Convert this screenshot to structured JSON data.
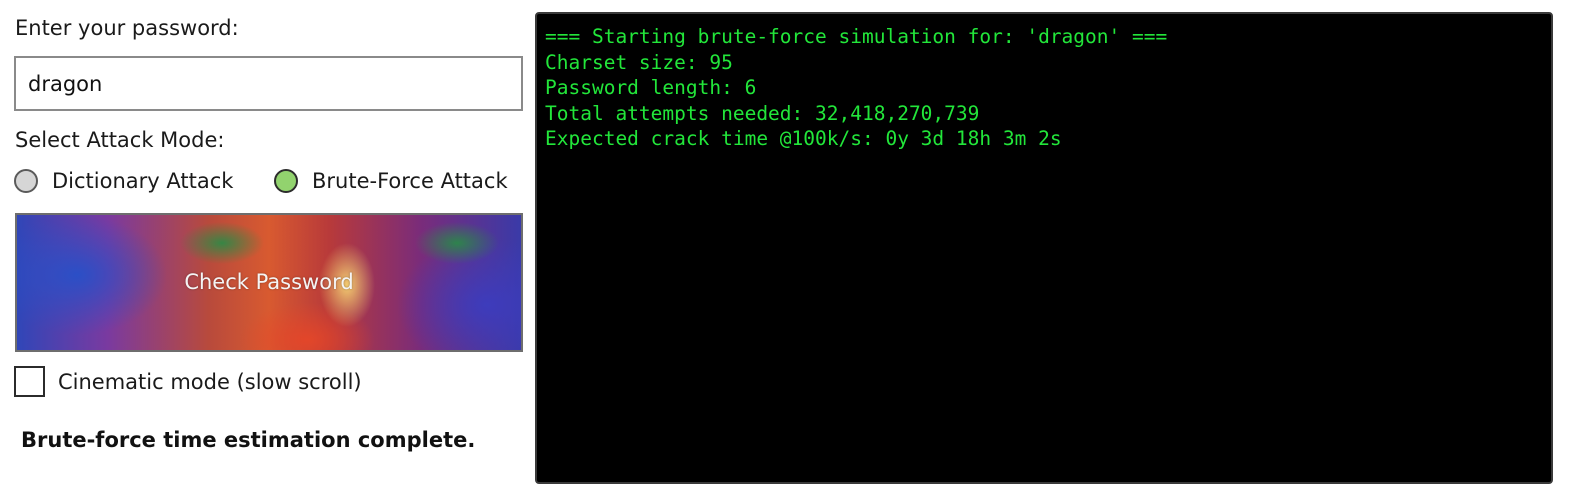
{
  "form": {
    "password_label": "Enter your password:",
    "password_value": "dragon",
    "mode_label": "Select Attack Mode:",
    "modes": [
      {
        "label": "Dictionary Attack",
        "selected": false
      },
      {
        "label": "Brute-Force Attack",
        "selected": true
      }
    ],
    "check_button_label": "Check Password",
    "cinematic_label": "Cinematic mode (slow scroll)",
    "cinematic_checked": false,
    "status_text": "Brute-force time estimation complete."
  },
  "terminal": {
    "lines": [
      "=== Starting brute-force simulation for: 'dragon' ===",
      "Charset size: 95",
      "Password length: 6",
      "Total attempts needed: 32,418,270,739",
      "Expected crack time @100k/s: 0y 3d 18h 3m 2s"
    ]
  },
  "colors": {
    "terminal_text": "#22e63a",
    "terminal_bg": "#000000",
    "radio_selected": "#92d36e"
  }
}
